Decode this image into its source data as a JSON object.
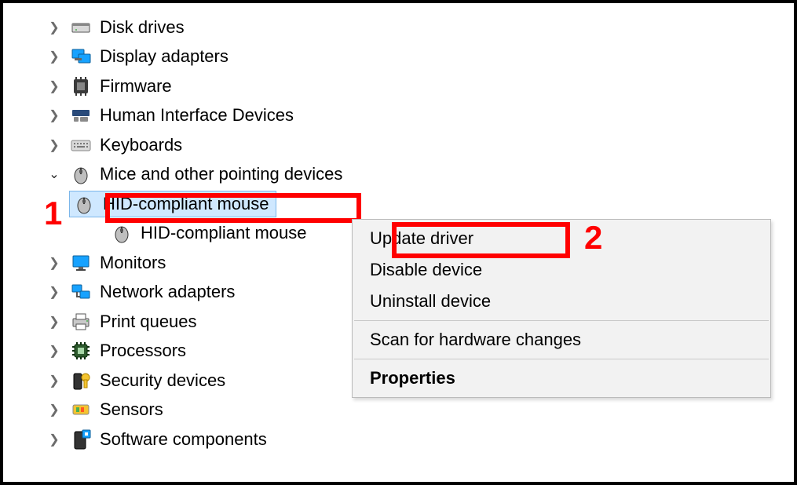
{
  "tree": {
    "disk_drives": "Disk drives",
    "display_adapters": "Display adapters",
    "firmware": "Firmware",
    "hid": "Human Interface Devices",
    "keyboards": "Keyboards",
    "mice": "Mice and other pointing devices",
    "mice_children": {
      "hid_mouse_1": "HID-compliant mouse",
      "hid_mouse_2": "HID-compliant mouse"
    },
    "monitors": "Monitors",
    "network_adapters": "Network adapters",
    "print_queues": "Print queues",
    "processors": "Processors",
    "security_devices": "Security devices",
    "sensors": "Sensors",
    "software_components": "Software components"
  },
  "context_menu": {
    "update_driver": "Update driver",
    "disable_device": "Disable device",
    "uninstall_device": "Uninstall device",
    "scan_hardware": "Scan for hardware changes",
    "properties": "Properties"
  },
  "annotations": {
    "one": "1",
    "two": "2"
  }
}
